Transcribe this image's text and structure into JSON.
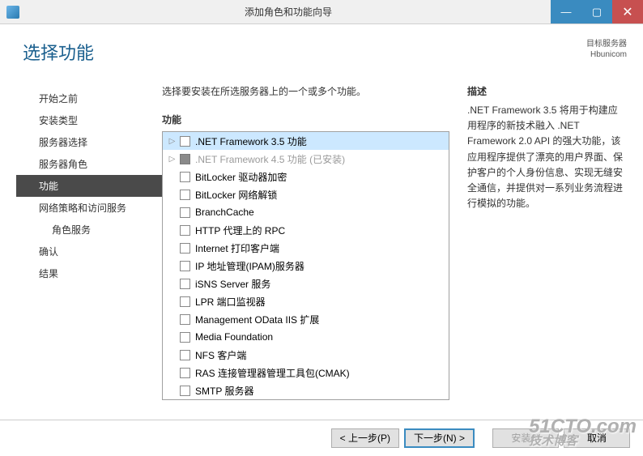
{
  "titlebar": {
    "title": "添加角色和功能向导"
  },
  "header": {
    "page_title": "选择功能",
    "target_label": "目标服务器",
    "target_value": "Hbunicom"
  },
  "sidebar": {
    "items": [
      {
        "label": "开始之前"
      },
      {
        "label": "安装类型"
      },
      {
        "label": "服务器选择"
      },
      {
        "label": "服务器角色"
      },
      {
        "label": "功能"
      },
      {
        "label": "网络策略和访问服务"
      },
      {
        "label": "角色服务"
      },
      {
        "label": "确认"
      },
      {
        "label": "结果"
      }
    ]
  },
  "center": {
    "intro": "选择要安装在所选服务器上的一个或多个功能。",
    "section_label": "功能"
  },
  "features": [
    {
      "label": ".NET Framework 3.5 功能",
      "expandable": true,
      "selected": true
    },
    {
      "label": ".NET Framework 4.5 功能 (已安装)",
      "expandable": true,
      "disabled": true,
      "checked_partial": true
    },
    {
      "label": "BitLocker 驱动器加密"
    },
    {
      "label": "BitLocker 网络解锁"
    },
    {
      "label": "BranchCache"
    },
    {
      "label": "HTTP 代理上的 RPC"
    },
    {
      "label": "Internet 打印客户端"
    },
    {
      "label": "IP 地址管理(IPAM)服务器"
    },
    {
      "label": "iSNS Server 服务"
    },
    {
      "label": "LPR 端口监视器"
    },
    {
      "label": "Management OData IIS 扩展"
    },
    {
      "label": "Media Foundation"
    },
    {
      "label": "NFS 客户端"
    },
    {
      "label": "RAS 连接管理器管理工具包(CMAK)"
    },
    {
      "label": "SMTP 服务器"
    }
  ],
  "description": {
    "label": "描述",
    "text": ".NET Framework 3.5 将用于构建应用程序的新技术融入 .NET Framework 2.0 API 的强大功能，该应用程序提供了漂亮的用户界面、保护客户的个人身份信息、实现无缝安全通信，并提供对一系列业务流程进行模拟的功能。"
  },
  "footer": {
    "prev": "< 上一步(P)",
    "next": "下一步(N) >",
    "install": "安装(I)",
    "cancel": "取消"
  },
  "watermark": {
    "line1": "51CTO.com",
    "line2": "技术博客"
  }
}
